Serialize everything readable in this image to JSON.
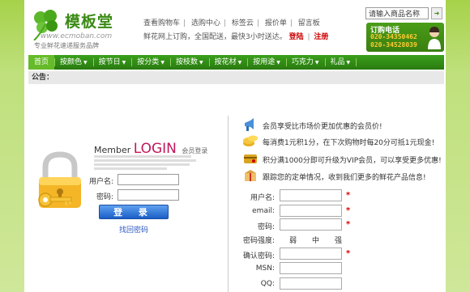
{
  "header": {
    "logo_title": "模板堂",
    "logo_url": "www.ecmoban.com",
    "logo_sub": "专业鲜花速递服务品牌",
    "links": [
      "查看购物车",
      "选购中心",
      "标签云",
      "报价单",
      "留言板"
    ],
    "welcome_text": "鲜花网上订购，全国配送，最快3小时送达。",
    "login_link": "登陆",
    "register_link": "注册",
    "search_placeholder": "请输入商品名称",
    "search_icon": "go-arrow-icon",
    "hotline_label": "订购电话",
    "hotline_numbers": [
      "020-34350462",
      "020-34528039"
    ]
  },
  "nav": {
    "items": [
      {
        "label": "首页",
        "arrow": ""
      },
      {
        "label": "按颜色",
        "arrow": "▼"
      },
      {
        "label": "按节日",
        "arrow": "▼"
      },
      {
        "label": "按分类",
        "arrow": "▼"
      },
      {
        "label": "按枝数",
        "arrow": "▼"
      },
      {
        "label": "按花材",
        "arrow": "▼"
      },
      {
        "label": "按用途",
        "arrow": "▼"
      },
      {
        "label": "巧克力",
        "arrow": "▼"
      },
      {
        "label": "礼品",
        "arrow": "▼"
      }
    ]
  },
  "notice_label": "公告：",
  "login": {
    "title_prefix": "Member",
    "title_main": "LOGIN",
    "title_cn": "会员登录",
    "username_label": "用户名:",
    "password_label": "密码:",
    "submit_label": "登 录",
    "forgot_label": "找回密码"
  },
  "benefits": [
    "会员享受比市场价更加优惠的会员价!",
    "每消费1元积1分，在下次购物时每20分可抵1元现金!",
    "积分满1000分即可升级为VIP会员，可以享受更多优惠!",
    "跟踪您的定单情况，收到我们更多的鲜花产品信息!"
  ],
  "register": {
    "fields": [
      {
        "label": "用户名:",
        "required": "*"
      },
      {
        "label": "email:",
        "required": "*"
      },
      {
        "label": "密码:",
        "required": "*"
      },
      {
        "label": "密码强度:",
        "required": ""
      },
      {
        "label": "确认密码:",
        "required": "*"
      },
      {
        "label": "MSN:",
        "required": ""
      },
      {
        "label": "QQ:",
        "required": ""
      }
    ],
    "strength_levels": [
      "弱",
      "中",
      "强"
    ]
  },
  "colors": {
    "brand_green": "#3a8a14",
    "nav_green": "#2a7a10",
    "login_pink": "#c2185b",
    "button_blue": "#1b5fc6",
    "required_red": "#d00"
  }
}
